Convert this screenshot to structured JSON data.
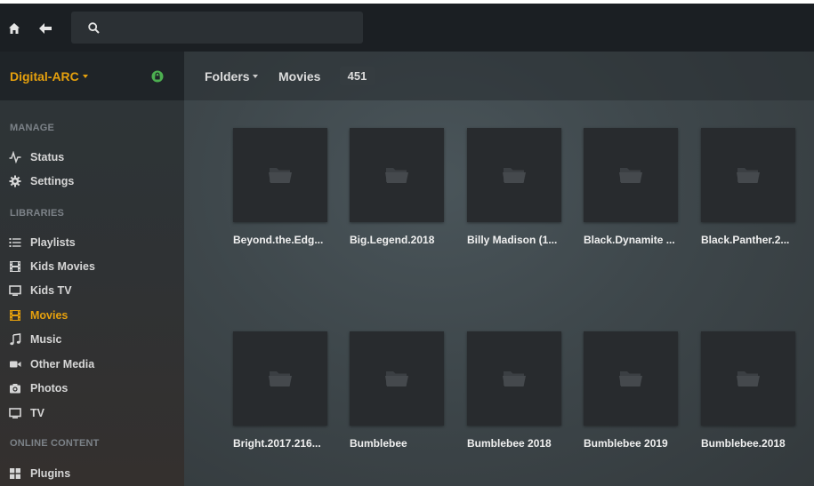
{
  "topbar": {
    "search": {
      "value": "",
      "placeholder": ""
    }
  },
  "server": {
    "name": "Digital-ARC"
  },
  "sidebar": {
    "sections": {
      "manage": "MANAGE",
      "libraries": "LIBRARIES",
      "online": "ONLINE CONTENT"
    },
    "manage_items": [
      {
        "label": "Status",
        "icon": "activity-icon"
      },
      {
        "label": "Settings",
        "icon": "gear-icon"
      }
    ],
    "library_items": [
      {
        "label": "Playlists",
        "icon": "list-icon"
      },
      {
        "label": "Kids Movies",
        "icon": "film-icon"
      },
      {
        "label": "Kids TV",
        "icon": "tv-icon"
      },
      {
        "label": "Movies",
        "icon": "film-icon",
        "active": true
      },
      {
        "label": "Music",
        "icon": "music-icon"
      },
      {
        "label": "Other Media",
        "icon": "video-camera-icon"
      },
      {
        "label": "Photos",
        "icon": "camera-icon"
      },
      {
        "label": "TV",
        "icon": "tv-icon"
      }
    ],
    "online_items": [
      {
        "label": "Plugins",
        "icon": "grid-icon"
      }
    ]
  },
  "main": {
    "header": {
      "folders_label": "Folders",
      "library_label": "Movies",
      "count": "451"
    },
    "tiles": [
      {
        "title": "Beyond.the.Edg..."
      },
      {
        "title": "Big.Legend.2018"
      },
      {
        "title": "Billy Madison (1..."
      },
      {
        "title": "Black.Dynamite ..."
      },
      {
        "title": "Black.Panther.2..."
      },
      {
        "title": "Bright.2017.216..."
      },
      {
        "title": "Bumblebee"
      },
      {
        "title": "Bumblebee 2018"
      },
      {
        "title": "Bumblebee 2019"
      },
      {
        "title": "Bumblebee.2018"
      }
    ]
  },
  "colors": {
    "accent": "#e5a00d",
    "secure": "#4caf50"
  }
}
